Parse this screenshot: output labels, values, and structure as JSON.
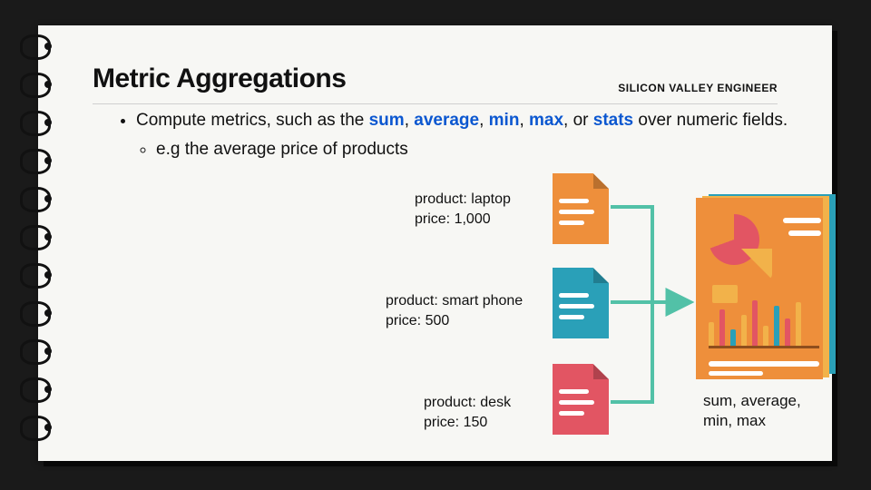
{
  "header": {
    "title": "Metric Aggregations",
    "brand": "SILICON VALLEY ENGINEER"
  },
  "bullet": {
    "pre": "Compute metrics, such as the ",
    "kw1": "sum",
    "sep1": ", ",
    "kw2": "average",
    "sep2": ", ",
    "kw3": "min",
    "sep3": ", ",
    "kw4": "max",
    "sep4": ", or ",
    "kw5": "stats",
    "post": " over numeric fields."
  },
  "sub": {
    "text": "e.g the average price of products"
  },
  "docs": [
    {
      "product": "laptop",
      "price": "1,000",
      "color": "#ee8f3b"
    },
    {
      "product": "smart phone",
      "price": "500",
      "color": "#2aa0b8"
    },
    {
      "product": "desk",
      "price": "150",
      "color": "#e25563"
    }
  ],
  "labels": {
    "product_prefix": "product: ",
    "price_prefix": "price: "
  },
  "report_caption": "sum, average,\nmin, max"
}
